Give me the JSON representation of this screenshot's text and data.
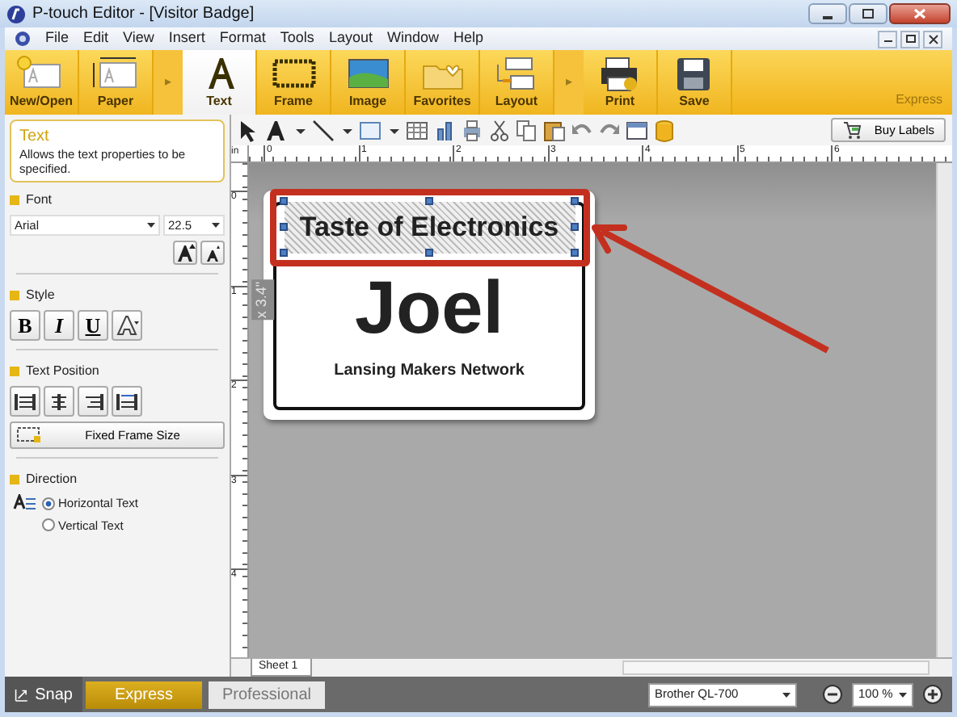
{
  "window": {
    "title": "P-touch Editor - [Visitor Badge]"
  },
  "menu": [
    "File",
    "Edit",
    "View",
    "Insert",
    "Format",
    "Tools",
    "Layout",
    "Window",
    "Help"
  ],
  "ribbon": {
    "groups": [
      {
        "label": "New/Open",
        "kind": "new",
        "selected": false
      },
      {
        "label": "Paper",
        "kind": "paper",
        "selected": false
      },
      {
        "label": "▸",
        "kind": "sep"
      },
      {
        "label": "Text",
        "kind": "text",
        "selected": true
      },
      {
        "label": "Frame",
        "kind": "frame",
        "selected": false
      },
      {
        "label": "Image",
        "kind": "image",
        "selected": false
      },
      {
        "label": "Favorites",
        "kind": "favorites",
        "selected": false
      },
      {
        "label": "Layout",
        "kind": "layout",
        "selected": false
      },
      {
        "label": "▸",
        "kind": "sep"
      },
      {
        "label": "Print",
        "kind": "print",
        "selected": false
      },
      {
        "label": "Save",
        "kind": "save",
        "selected": false
      }
    ],
    "mode_label": "Express"
  },
  "toolbar": {
    "buy_labels": "Buy Labels"
  },
  "properties": {
    "title": "Text",
    "description": "Allows the text properties to be specified.",
    "font_section": "Font",
    "font": "Arial",
    "size": "22.5",
    "style_section": "Style",
    "style_buttons": [
      "B",
      "I",
      "U"
    ],
    "text_position_section": "Text Position",
    "fixed_frame_size": "Fixed Frame Size",
    "direction_section": "Direction",
    "directions": [
      {
        "label": "Horizontal Text",
        "selected": true
      },
      {
        "label": "Vertical Text",
        "selected": false
      }
    ]
  },
  "ruler": {
    "unit": "in",
    "h_marks": [
      "0",
      "1",
      "2",
      "3",
      "4",
      "5",
      "6"
    ],
    "v_marks": [
      "0",
      "1",
      "2",
      "3",
      "4"
    ]
  },
  "label": {
    "size_note": "x 3.4\"",
    "texts": [
      {
        "text": "Taste of Electronics",
        "kind": "title",
        "selected": true,
        "highlighted": true
      },
      {
        "text": "Joel",
        "kind": "name",
        "selected": false,
        "highlighted": false
      },
      {
        "text": "Lansing Makers Network",
        "kind": "org",
        "selected": false,
        "highlighted": false
      }
    ]
  },
  "sheets": [
    {
      "label": "Sheet 1",
      "selected": true
    }
  ],
  "bottom": {
    "snap": "Snap",
    "modes": [
      {
        "label": "Express",
        "selected": true
      },
      {
        "label": "Professional",
        "selected": false
      }
    ],
    "printer": "Brother QL-700",
    "zoom": "100 %"
  }
}
